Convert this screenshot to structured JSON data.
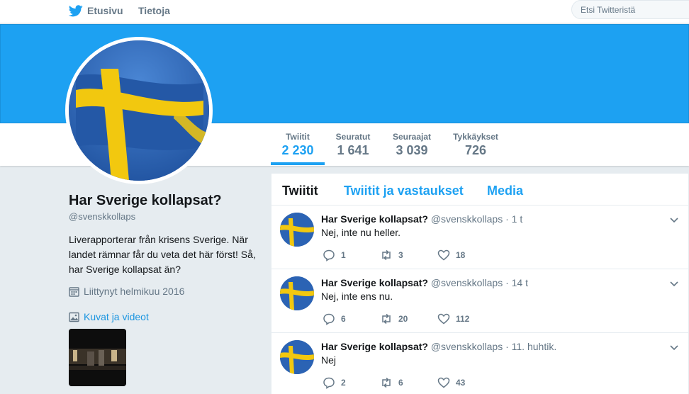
{
  "topnav": {
    "home_label": "Etusivu",
    "about_label": "Tietoja",
    "search_placeholder": "Etsi Twitteristä"
  },
  "colors": {
    "accent": "#1da1f2",
    "link": "#1b95e0",
    "text": "#14171a",
    "muted": "#657786",
    "flag_blue": "#2b5a9e",
    "flag_yellow": "#f2c80f"
  },
  "stats": [
    {
      "label": "Twiitit",
      "value": "2 230"
    },
    {
      "label": "Seuratut",
      "value": "1 641"
    },
    {
      "label": "Seuraajat",
      "value": "3 039"
    },
    {
      "label": "Tykkäykset",
      "value": "726"
    }
  ],
  "profile": {
    "name": "Har Sverige kollapsat?",
    "handle": "@svenskkollaps",
    "bio": "Liverapporterar från krisens Sverige. När landet rämnar får du veta det här först! Så, har Sverige kollapsat än?",
    "joined": "Liittynyt helmikuu 2016",
    "media_link": "Kuvat ja videot"
  },
  "tabs": [
    "Twiitit",
    "Twiitit ja vastaukset",
    "Media"
  ],
  "tweets": [
    {
      "name": "Har Sverige kollapsat?",
      "meta": "@svenskkollaps · 1 t",
      "text": "Nej, inte nu heller.",
      "replies": "1",
      "retweets": "3",
      "likes": "18"
    },
    {
      "name": "Har Sverige kollapsat?",
      "meta": "@svenskkollaps · 14 t",
      "text": "Nej, inte ens nu.",
      "replies": "6",
      "retweets": "20",
      "likes": "112"
    },
    {
      "name": "Har Sverige kollapsat?",
      "meta": "@svenskkollaps · 11. huhtik.",
      "text": "Nej",
      "replies": "2",
      "retweets": "6",
      "likes": "43"
    }
  ]
}
